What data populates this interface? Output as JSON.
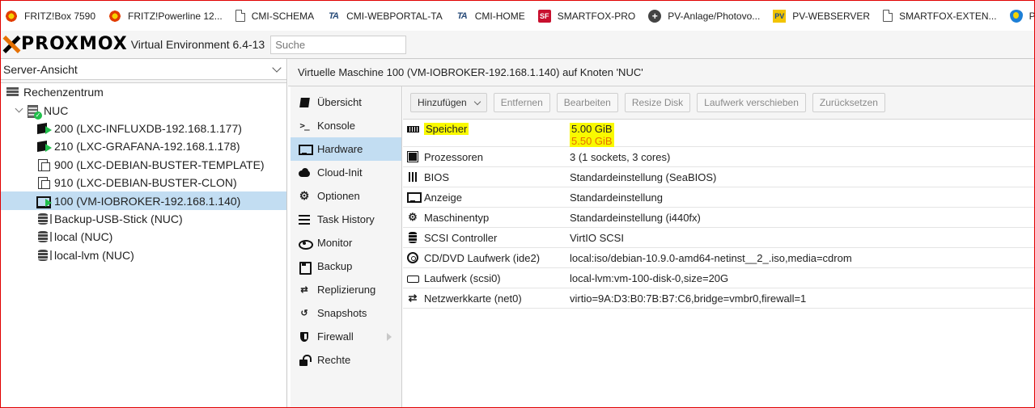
{
  "bookmarks": [
    {
      "label": "FRITZ!Box 7590",
      "icon": "fritz-icon",
      "cls": "ic-fritz",
      "glyph": ""
    },
    {
      "label": "FRITZ!Powerline 12...",
      "icon": "fritz-icon",
      "cls": "ic-fritz",
      "glyph": ""
    },
    {
      "label": "CMI-SCHEMA",
      "icon": "document-icon",
      "cls": "ic-doc",
      "glyph": ""
    },
    {
      "label": "CMI-WEBPORTAL-TA",
      "icon": "ta-logo-icon",
      "cls": "ic-tr",
      "glyph": "TA"
    },
    {
      "label": "CMI-HOME",
      "icon": "ta-logo-icon",
      "cls": "ic-tr",
      "glyph": "TA"
    },
    {
      "label": "SMARTFOX-PRO",
      "icon": "smartfox-icon",
      "cls": "ic-sf",
      "glyph": "SF"
    },
    {
      "label": "PV-Anlage/Photovo...",
      "icon": "plus-circle-icon",
      "cls": "ic-plus",
      "glyph": "+"
    },
    {
      "label": "PV-WEBSERVER",
      "icon": "pv-icon",
      "cls": "ic-pv",
      "glyph": "PV"
    },
    {
      "label": "SMARTFOX-EXTEN...",
      "icon": "document-icon",
      "cls": "ic-doc",
      "glyph": ""
    },
    {
      "label": "PV-FORUM",
      "icon": "shield-logo-icon",
      "cls": "ic-shield",
      "glyph": ""
    }
  ],
  "header": {
    "logo_text": "PROXMOX",
    "version": "Virtual Environment 6.4-13",
    "search_placeholder": "Suche"
  },
  "tree": {
    "view_label": "Server-Ansicht",
    "items": [
      {
        "label": "Rechenzentrum",
        "level": 0,
        "icon": "datacenter-icon",
        "cls": "ico-dc",
        "expander": false,
        "selected": false
      },
      {
        "label": "NUC",
        "level": 1,
        "icon": "node-online-icon",
        "cls": "ico-node",
        "expander": true,
        "selected": false
      },
      {
        "label": "200 (LXC-INFLUXDB-192.168.1.177)",
        "level": 2,
        "icon": "container-running-icon",
        "cls": "ico-ct ico-ct-run",
        "expander": false,
        "selected": false
      },
      {
        "label": "210 (LXC-GRAFANA-192.168.1.178)",
        "level": 2,
        "icon": "container-running-icon",
        "cls": "ico-ct ico-ct-run",
        "expander": false,
        "selected": false
      },
      {
        "label": "900 (LXC-DEBIAN-BUSTER-TEMPLATE)",
        "level": 2,
        "icon": "template-icon",
        "cls": "ico-tmpl",
        "expander": false,
        "selected": false
      },
      {
        "label": "910 (LXC-DEBIAN-BUSTER-CLON)",
        "level": 2,
        "icon": "template-icon",
        "cls": "ico-tmpl",
        "expander": false,
        "selected": false
      },
      {
        "label": "100 (VM-IOBROKER-192.168.1.140)",
        "level": 2,
        "icon": "vm-running-icon",
        "cls": "ico-vm ico-ct-run",
        "expander": false,
        "selected": true
      },
      {
        "label": "Backup-USB-Stick (NUC)",
        "level": 2,
        "icon": "storage-icon",
        "cls": "ico-storage",
        "expander": false,
        "selected": false
      },
      {
        "label": "local (NUC)",
        "level": 2,
        "icon": "storage-icon",
        "cls": "ico-storage",
        "expander": false,
        "selected": false
      },
      {
        "label": "local-lvm (NUC)",
        "level": 2,
        "icon": "storage-icon",
        "cls": "ico-storage",
        "expander": false,
        "selected": false
      }
    ]
  },
  "main": {
    "title": "Virtuelle Maschine 100 (VM-IOBROKER-192.168.1.140) auf Knoten 'NUC'",
    "nav": [
      {
        "label": "Übersicht",
        "icon": "book-icon",
        "cls": "ni-book",
        "glyph": "",
        "selected": false,
        "arrow": false
      },
      {
        "label": "Konsole",
        "icon": "terminal-icon",
        "cls": "ni-term",
        "glyph": ">_",
        "selected": false,
        "arrow": false
      },
      {
        "label": "Hardware",
        "icon": "desktop-icon",
        "cls": "ni-desk",
        "glyph": "",
        "selected": true,
        "arrow": false
      },
      {
        "label": "Cloud-Init",
        "icon": "cloud-icon",
        "cls": "ni-cloud",
        "glyph": "",
        "selected": false,
        "arrow": false
      },
      {
        "label": "Optionen",
        "icon": "gear-icon",
        "cls": "ni-gear",
        "glyph": "⚙",
        "selected": false,
        "arrow": false
      },
      {
        "label": "Task History",
        "icon": "list-icon",
        "cls": "ni-list",
        "glyph": "",
        "selected": false,
        "arrow": false
      },
      {
        "label": "Monitor",
        "icon": "eye-icon",
        "cls": "ni-eye",
        "glyph": "",
        "selected": false,
        "arrow": false
      },
      {
        "label": "Backup",
        "icon": "floppy-icon",
        "cls": "ni-floppy",
        "glyph": "",
        "selected": false,
        "arrow": false
      },
      {
        "label": "Replizierung",
        "icon": "retweet-icon",
        "cls": "",
        "glyph": "⇄",
        "selected": false,
        "arrow": false
      },
      {
        "label": "Snapshots",
        "icon": "history-icon",
        "cls": "",
        "glyph": "↺",
        "selected": false,
        "arrow": false
      },
      {
        "label": "Firewall",
        "icon": "shield-icon",
        "cls": "ni-shield",
        "glyph": "",
        "selected": false,
        "arrow": true
      },
      {
        "label": "Rechte",
        "icon": "unlock-icon",
        "cls": "ni-unlock",
        "glyph": "",
        "selected": false,
        "arrow": false
      }
    ],
    "toolbar": {
      "add_label": "Hinzufügen",
      "remove_label": "Entfernen",
      "edit_label": "Bearbeiten",
      "resize_label": "Resize Disk",
      "move_label": "Laufwerk verschieben",
      "revert_label": "Zurücksetzen"
    },
    "hardware": [
      {
        "name": "Speicher",
        "value": "5.00 GiB",
        "pending": "5.50 GiB",
        "icon": "memory-icon",
        "cls": "hi-mem",
        "glyph": "",
        "highlight": true
      },
      {
        "name": "Prozessoren",
        "value": "3 (1 sockets, 3 cores)",
        "pending": "",
        "icon": "cpu-icon",
        "cls": "hi-cpu",
        "glyph": "",
        "highlight": false
      },
      {
        "name": "BIOS",
        "value": "Standardeinstellung (SeaBIOS)",
        "pending": "",
        "icon": "bios-icon",
        "cls": "hi-bios",
        "glyph": "",
        "highlight": false
      },
      {
        "name": "Anzeige",
        "value": "Standardeinstellung",
        "pending": "",
        "icon": "display-icon",
        "cls": "hi-disp",
        "glyph": "",
        "highlight": false
      },
      {
        "name": "Maschinentyp",
        "value": "Standardeinstellung (i440fx)",
        "pending": "",
        "icon": "cogs-icon",
        "cls": "hi-cogs",
        "glyph": "⚙",
        "highlight": false
      },
      {
        "name": "SCSI Controller",
        "value": "VirtIO SCSI",
        "pending": "",
        "icon": "database-icon",
        "cls": "hi-db",
        "glyph": "",
        "highlight": false
      },
      {
        "name": "CD/DVD Laufwerk (ide2)",
        "value": "local:iso/debian-10.9.0-amd64-netinst__2_.iso,media=cdrom",
        "pending": "",
        "icon": "cdrom-icon",
        "cls": "hi-cd",
        "glyph": "",
        "highlight": false
      },
      {
        "name": "Laufwerk (scsi0)",
        "value": "local-lvm:vm-100-disk-0,size=20G",
        "pending": "",
        "icon": "hdd-icon",
        "cls": "hi-hdd",
        "glyph": "",
        "highlight": false
      },
      {
        "name": "Netzwerkkarte (net0)",
        "value": "virtio=9A:D3:B0:7B:B7:C6,bridge=vmbr0,firewall=1",
        "pending": "",
        "icon": "network-exchange-icon",
        "cls": "hi-ex",
        "glyph": "⇄",
        "highlight": false
      }
    ]
  }
}
